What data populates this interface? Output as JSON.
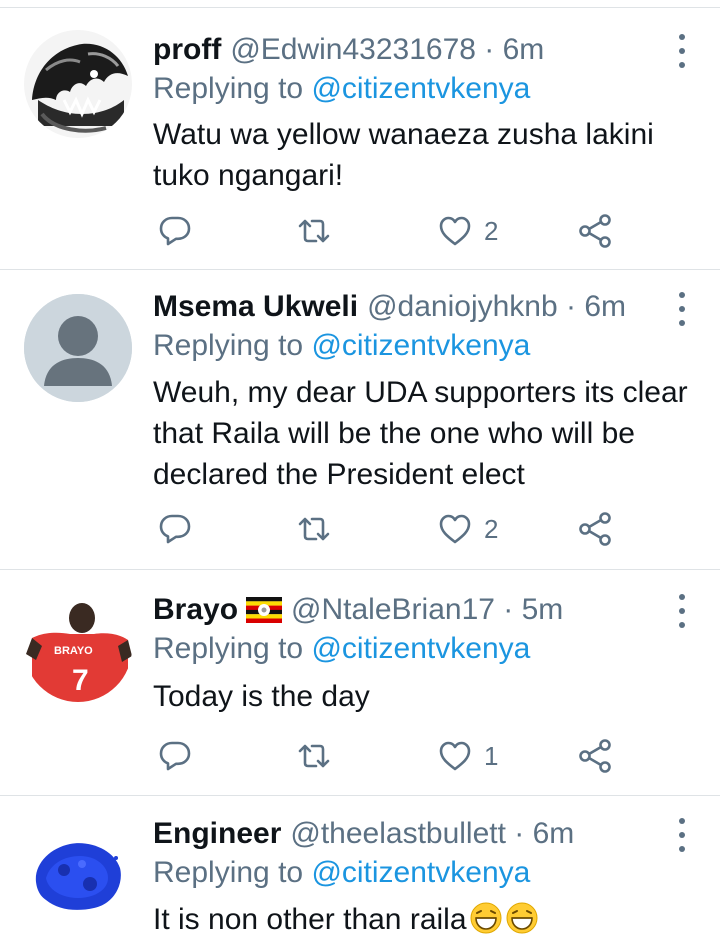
{
  "tweets": [
    {
      "name": "proff",
      "handle": "@Edwin43231678 · 6m",
      "reply_prefix": "Replying to ",
      "reply_to": "@citizentvkenya",
      "text": "Watu wa yellow  wanaeza zusha lakini tuko ngangari!",
      "likes": "2",
      "avatar": "wolf-illustration"
    },
    {
      "name": "Msema Ukweli",
      "handle": "@daniojyhknb · 6m",
      "reply_prefix": "Replying to ",
      "reply_to": "@citizentvkenya",
      "text": "Weuh, my dear UDA supporters its clear that Raila will be the one who will be declared the President elect",
      "likes": "2",
      "avatar": "default-profile"
    },
    {
      "name": "Brayo",
      "handle": "@NtaleBrian17 · 5m",
      "reply_prefix": "Replying to ",
      "reply_to": "@citizentvkenya",
      "text": "Today is the day",
      "likes": "1",
      "avatar": "red-jersey",
      "jersey_name": "BRAYO",
      "jersey_number": "7"
    },
    {
      "name": "Engineer",
      "handle": "@theelastbullett · 6m",
      "reply_prefix": "Replying to ",
      "reply_to": "@citizentvkenya",
      "text": "It is non other than raila",
      "avatar": "blue-pigment"
    }
  ],
  "icons": {
    "reply": "reply-icon",
    "retweet": "retweet-icon",
    "like": "heart-icon",
    "share": "share-icon",
    "more": "more-icon",
    "flag": "uganda-flag-icon",
    "emoji": "laughing-emoji"
  },
  "colors": {
    "text": "#0f1419",
    "secondary": "#5b7083",
    "mention": "#1b95e0",
    "divider": "#dfe3e6"
  }
}
